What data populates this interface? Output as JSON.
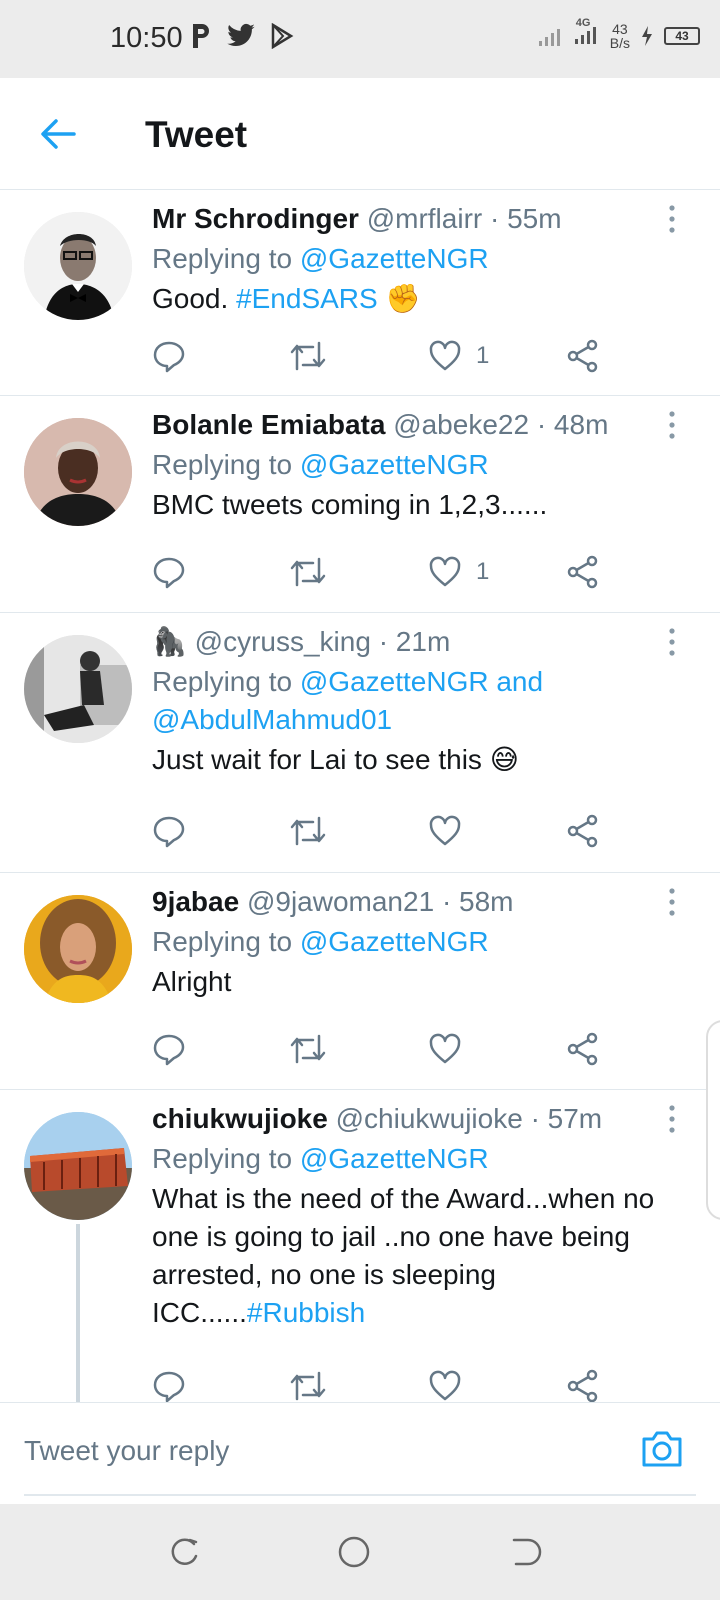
{
  "status_bar": {
    "time": "10:50",
    "net_speed_value": "43",
    "net_speed_unit": "B/s",
    "network_type": "4G",
    "battery": "43"
  },
  "header": {
    "title": "Tweet"
  },
  "tweets": [
    {
      "name": "Mr Schrodinger",
      "handle": "@mrflairr",
      "time": "· 55m",
      "reply_label": "Replying to",
      "reply_to": "@GazetteNGR",
      "reply_to_2": "",
      "text": "Good. ",
      "hashtag": "#EndSARS",
      "emoji": "✊",
      "likes": "1"
    },
    {
      "name": "Bolanle Emiabata",
      "handle": "@abeke22",
      "time": "· 48m",
      "reply_label": "Replying to",
      "reply_to": "@GazetteNGR",
      "reply_to_2": "",
      "text": "BMC tweets coming in 1,2,3......",
      "hashtag": "",
      "emoji": "",
      "likes": "1"
    },
    {
      "name": "🦍",
      "handle": "@cyruss_king",
      "time": "· 21m",
      "reply_label": "Replying to",
      "reply_to": "@GazetteNGR and",
      "reply_to_2": "@AbdulMahmud01",
      "text": "Just wait for Lai to see this ",
      "hashtag": "",
      "emoji": "😅",
      "likes": ""
    },
    {
      "name": "9jabae",
      "handle": "@9jawoman21",
      "time": "· 58m",
      "reply_label": "Replying to",
      "reply_to": "@GazetteNGR",
      "reply_to_2": "",
      "text": "Alright",
      "hashtag": "",
      "emoji": "",
      "likes": ""
    },
    {
      "name": "chiukwujioke",
      "handle": "@chiukwujioke",
      "time": "· 57m",
      "reply_label": "Replying to",
      "reply_to": "@GazetteNGR",
      "reply_to_2": "",
      "text": "What is the need of the Award...when no one is going to jail ..no one have being arrested, no one is sleeping ICC......",
      "hashtag": "#Rubbish",
      "emoji": "",
      "likes": ""
    }
  ],
  "reply_bar": {
    "placeholder": "Tweet your reply"
  },
  "colors": {
    "accent": "#1da1f2",
    "secondary_text": "#657786",
    "divider": "#e1e8ed"
  }
}
